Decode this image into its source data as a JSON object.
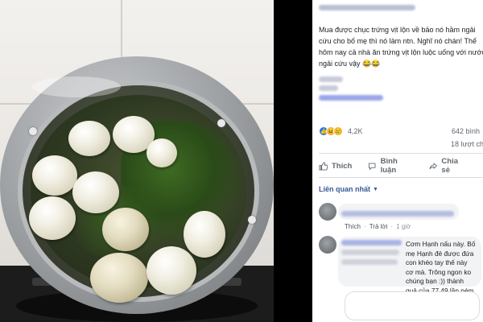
{
  "photo": {
    "subject": "boiled-duck-eggs-in-pot",
    "colors": {
      "pot": "#9a9da0",
      "water": "#2f3a22",
      "egg": "#f2f0e4",
      "stove": "#1c1c1c"
    }
  },
  "post": {
    "caption": "Mua được chục trứng vịt lộn về bảo nó hầm ngải\ncứu cho bố mẹ thì nó làm ntn. Nghĩ nó chán! Thế\nhôm nay cả nhà ăn trứng vịt lộn luộc uống với nước\nngải cứu vậy 😂😂",
    "reactions": {
      "icons": [
        "like-icon",
        "haha-icon",
        "sad-icon"
      ],
      "count": "4,2K",
      "comments": "642 bình",
      "shares": "18 lượt ch"
    },
    "actions": [
      {
        "label": "Thích",
        "icon": "like-thumb-icon"
      },
      {
        "label": "Bình luận",
        "icon": "comment-icon"
      },
      {
        "label": "Chia sẻ",
        "icon": "share-icon"
      }
    ],
    "filter_label": "Liên quan nhất",
    "filter_caret": "▼"
  },
  "comments": [
    {
      "meta_like": "Thích",
      "meta_sep": "·",
      "meta_reply": "Trả lời",
      "meta_time": "1 giờ"
    },
    {
      "text": "Cơm Hạnh nấu này. Bố\nmẹ Hạnh đẻ được đứa con khéo tay thế này\ncơ mà. Trông ngon ko chúng bạn :)) thành\nquả của 77 49 lần ném nếm đấy :)) vất và\nvất và vl :))"
    }
  ],
  "accent": "#385898",
  "link_blue": "#1877f2"
}
